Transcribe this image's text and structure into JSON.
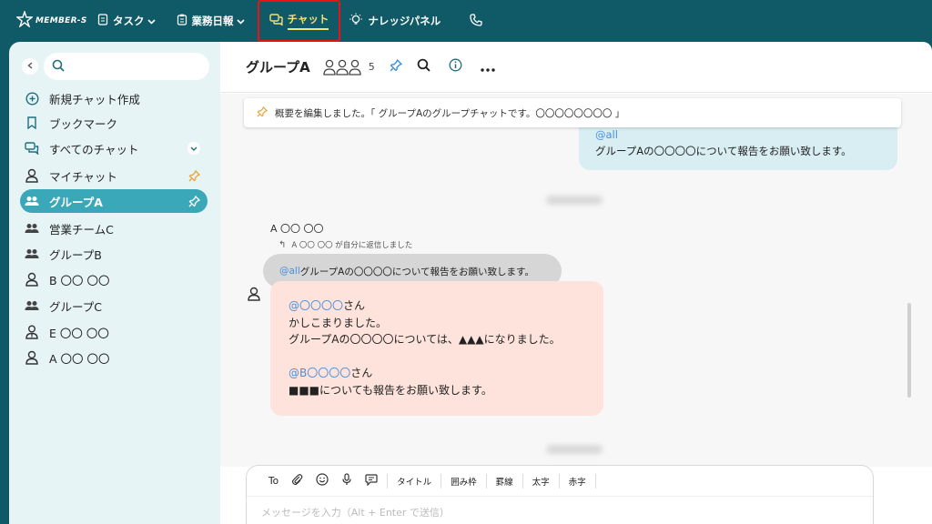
{
  "app": {
    "logo_text": "MEMBER-S"
  },
  "nav": [
    {
      "label": "タスク",
      "icon": "document-icon",
      "dropdown": true
    },
    {
      "label": "業務日報",
      "icon": "clipboard-icon",
      "dropdown": true
    },
    {
      "label": "チャット",
      "icon": "chat-icon",
      "active": true
    },
    {
      "label": "ナレッジパネル",
      "icon": "lightbulb-icon"
    },
    {
      "label": "",
      "icon": "phone-icon"
    }
  ],
  "sidebar": {
    "items": [
      {
        "label": "新規チャット作成",
        "icon": "plus-circle-icon"
      },
      {
        "label": "ブックマーク",
        "icon": "bookmark-icon"
      },
      {
        "label": "すべてのチャット",
        "icon": "chat-bubbles-icon",
        "expand": true
      },
      {
        "label": "マイチャット",
        "icon": "person-icon",
        "pinned": true
      },
      {
        "label": "グループA",
        "icon": "group-icon",
        "pinned": true,
        "active": true
      },
      {
        "label": "営業チームC",
        "icon": "group-icon"
      },
      {
        "label": "グループB",
        "icon": "group-icon"
      },
      {
        "label": "B 〇〇 〇〇",
        "icon": "person-icon"
      },
      {
        "label": "グループC",
        "icon": "group-icon"
      },
      {
        "label": "E 〇〇 〇〇",
        "icon": "person-tie-icon"
      },
      {
        "label": "A 〇〇 〇〇",
        "icon": "person-icon"
      }
    ]
  },
  "chat": {
    "title": "グループA",
    "member_count": "5",
    "notice": "概要を編集しました。「 グループAのグループチャットです。〇〇〇〇〇〇〇〇 」",
    "top_message": {
      "mention": "@all",
      "text": "グループAの〇〇〇〇について報告をお願い致します。"
    },
    "sender": "A 〇〇 〇〇",
    "reply_note": "A 〇〇 〇〇 が自分に返信しました",
    "quote": {
      "mention": "@all",
      "text": " グループAの〇〇〇〇について報告をお願い致します。"
    },
    "reply": {
      "line1_mention": "@〇〇〇〇",
      "line1_suffix": "さん",
      "line2": "かしこまりました。",
      "line3": "グループAの〇〇〇〇については、▲▲▲になりました。",
      "line5_mention": "@B〇〇〇〇",
      "line5_suffix": "さん",
      "line6": "■■■についても報告をお願い致します。"
    }
  },
  "composer": {
    "to_label": "To",
    "format_buttons": [
      "タイトル",
      "囲み枠",
      "罫線",
      "太字",
      "赤字"
    ],
    "placeholder": "メッセージを入力（Alt + Enter で送信）"
  },
  "colors": {
    "header_bg": "#0f5a66",
    "sidebar_bg": "#e6f4f6",
    "active_item": "#3aa8b8",
    "active_nav": "#f4e27a",
    "highlight_box": "#e11111",
    "mention": "#4a8fd8",
    "own_bubble": "#d9eef2",
    "reply_bubble": "#fde3db",
    "pin": "#e8a23a"
  }
}
